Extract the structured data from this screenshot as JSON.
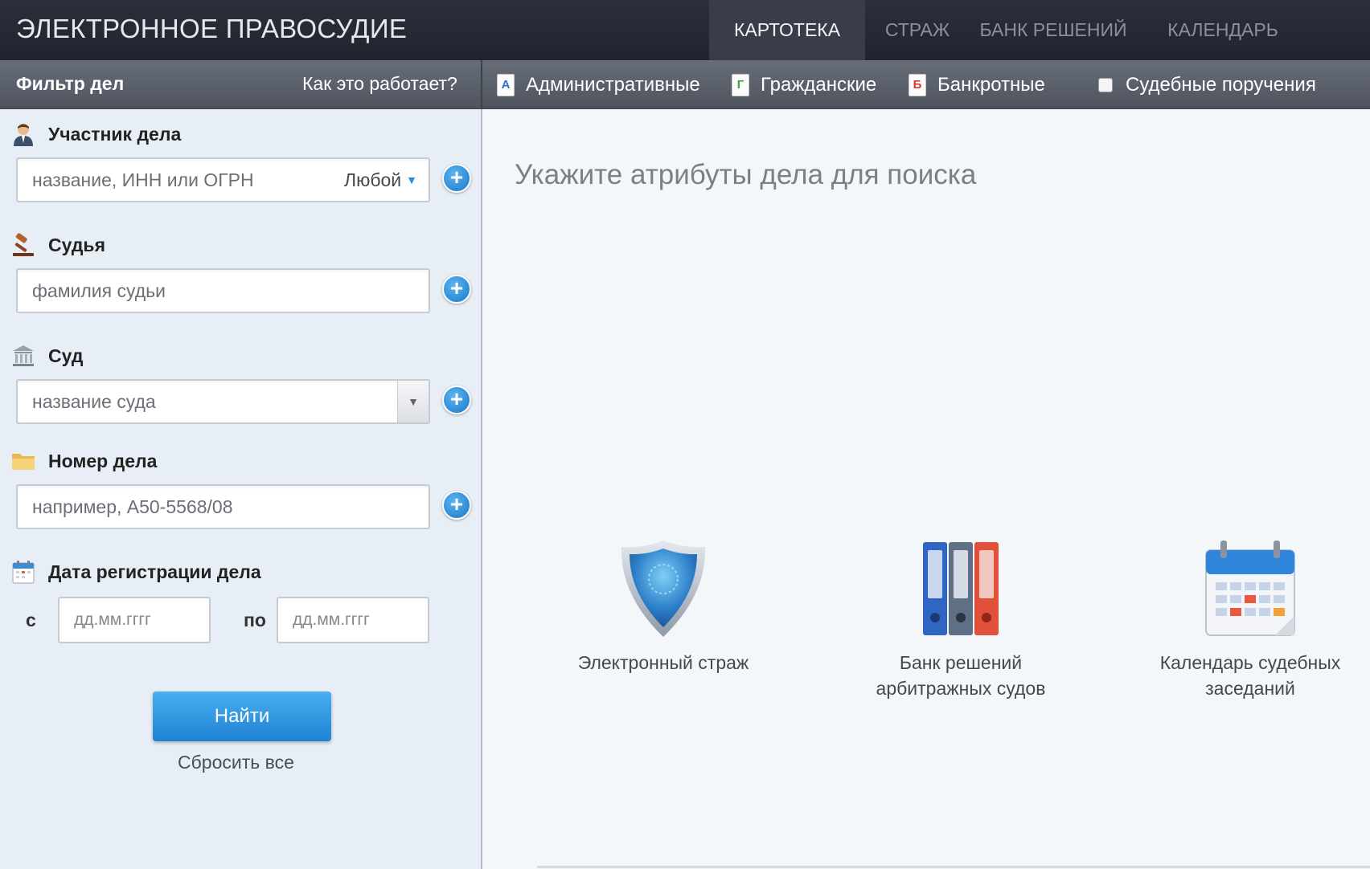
{
  "header": {
    "brand": "ЭЛЕКТРОННОЕ ПРАВОСУДИЕ",
    "tabs": [
      {
        "label": "КАРТОТЕКА",
        "active": true
      },
      {
        "label": "СТРАЖ",
        "active": false
      },
      {
        "label": "БАНК РЕШЕНИЙ",
        "active": false
      },
      {
        "label": "КАЛЕНДАРЬ",
        "active": false
      }
    ]
  },
  "subbar": {
    "filter_title": "Фильтр дел",
    "how_link": "Как это работает?",
    "categories": [
      {
        "label": "Административные",
        "icon_letter": "А",
        "icon": "administrative-doc-icon"
      },
      {
        "label": "Гражданские",
        "icon_letter": "Г",
        "icon": "civil-doc-icon"
      },
      {
        "label": "Банкротные",
        "icon_letter": "Б",
        "icon": "bankruptcy-doc-icon"
      },
      {
        "label": "Судебные поручения",
        "icon": "checkbox"
      }
    ]
  },
  "filter": {
    "participant": {
      "label": "Участник дела",
      "placeholder": "название, ИНН или ОГРН",
      "role": "Любой"
    },
    "judge": {
      "label": "Судья",
      "placeholder": "фамилия судьи"
    },
    "court": {
      "label": "Суд",
      "placeholder": "название суда"
    },
    "case_number": {
      "label": "Номер дела",
      "placeholder": "например, А50-5568/08"
    },
    "date": {
      "label": "Дата регистрации дела",
      "from_label": "с",
      "to_label": "по",
      "from_placeholder": "дд.мм.гггг",
      "to_placeholder": "дд.мм.гггг"
    },
    "find_button": "Найти",
    "reset_link": "Сбросить все"
  },
  "main": {
    "title": "Укажите атрибуты дела для поиска",
    "promos": [
      {
        "line1": "Электронный страж",
        "line2": "",
        "icon": "shield-icon"
      },
      {
        "line1": "Банк решений",
        "line2": "арбитражных судов",
        "icon": "binders-icon"
      },
      {
        "line1": "Календарь судебных",
        "line2": "заседаний",
        "icon": "calendar-icon"
      }
    ]
  },
  "colors": {
    "topbar": "#23272f",
    "subbar": "#5c616b",
    "button": "#2b8fdd",
    "accent": "#1a77c9"
  }
}
